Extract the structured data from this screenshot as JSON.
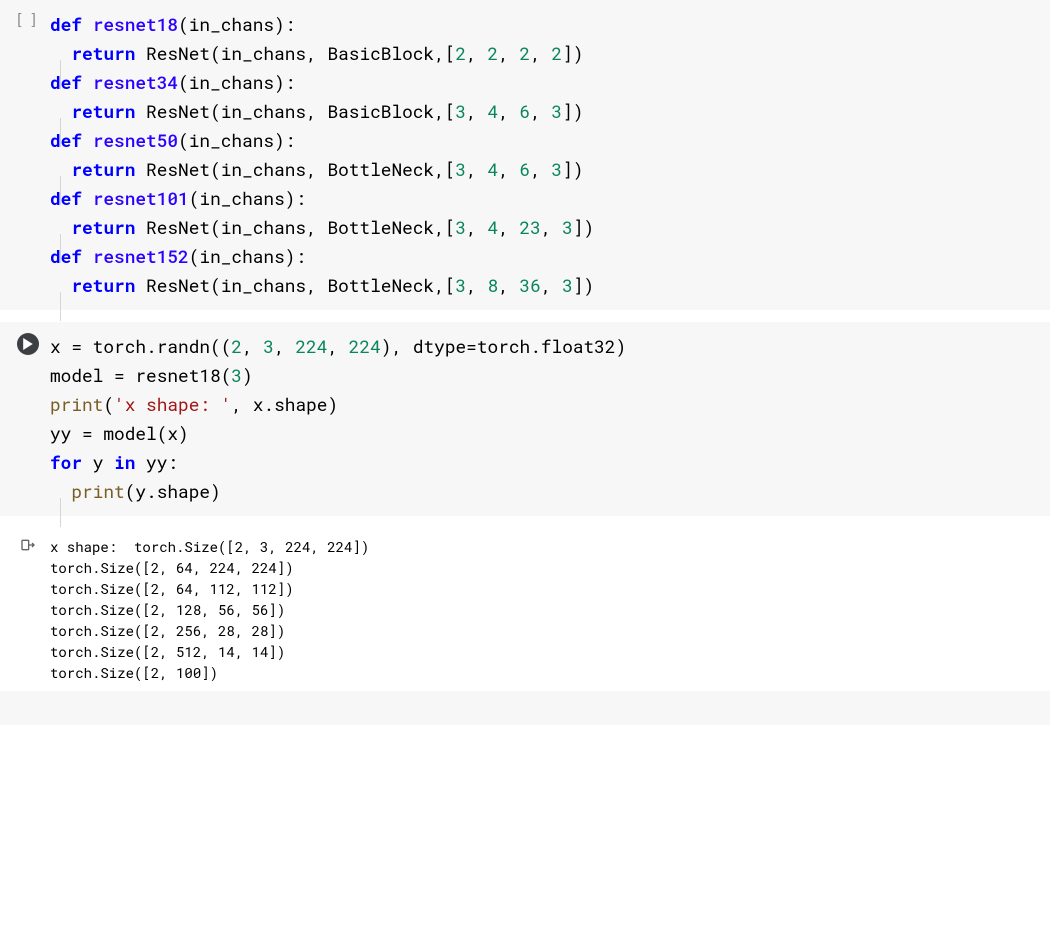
{
  "cells": [
    {
      "status": "idle",
      "code": [
        [
          {
            "t": "def ",
            "c": "kw"
          },
          {
            "t": "resnet18",
            "c": "fn"
          },
          {
            "t": "(in_chans):",
            "c": "op"
          }
        ],
        [
          {
            "t": "  ",
            "c": "op",
            "guide": true
          },
          {
            "t": "return ",
            "c": "kw"
          },
          {
            "t": "ResNet(in_chans, BasicBlock,[",
            "c": "op"
          },
          {
            "t": "2",
            "c": "num"
          },
          {
            "t": ", ",
            "c": "op"
          },
          {
            "t": "2",
            "c": "num"
          },
          {
            "t": ", ",
            "c": "op"
          },
          {
            "t": "2",
            "c": "num"
          },
          {
            "t": ", ",
            "c": "op"
          },
          {
            "t": "2",
            "c": "num"
          },
          {
            "t": "])",
            "c": "op"
          }
        ],
        [
          {
            "t": "",
            "c": "op"
          }
        ],
        [
          {
            "t": "def ",
            "c": "kw"
          },
          {
            "t": "resnet34",
            "c": "fn"
          },
          {
            "t": "(in_chans):",
            "c": "op"
          }
        ],
        [
          {
            "t": "  ",
            "c": "op",
            "guide": true
          },
          {
            "t": "return ",
            "c": "kw"
          },
          {
            "t": "ResNet(in_chans, BasicBlock,[",
            "c": "op"
          },
          {
            "t": "3",
            "c": "num"
          },
          {
            "t": ", ",
            "c": "op"
          },
          {
            "t": "4",
            "c": "num"
          },
          {
            "t": ", ",
            "c": "op"
          },
          {
            "t": "6",
            "c": "num"
          },
          {
            "t": ", ",
            "c": "op"
          },
          {
            "t": "3",
            "c": "num"
          },
          {
            "t": "])",
            "c": "op"
          }
        ],
        [
          {
            "t": "",
            "c": "op"
          }
        ],
        [
          {
            "t": "def ",
            "c": "kw"
          },
          {
            "t": "resnet50",
            "c": "fn"
          },
          {
            "t": "(in_chans):",
            "c": "op"
          }
        ],
        [
          {
            "t": "  ",
            "c": "op",
            "guide": true
          },
          {
            "t": "return ",
            "c": "kw"
          },
          {
            "t": "ResNet(in_chans, BottleNeck,[",
            "c": "op"
          },
          {
            "t": "3",
            "c": "num"
          },
          {
            "t": ", ",
            "c": "op"
          },
          {
            "t": "4",
            "c": "num"
          },
          {
            "t": ", ",
            "c": "op"
          },
          {
            "t": "6",
            "c": "num"
          },
          {
            "t": ", ",
            "c": "op"
          },
          {
            "t": "3",
            "c": "num"
          },
          {
            "t": "])",
            "c": "op"
          }
        ],
        [
          {
            "t": "",
            "c": "op"
          }
        ],
        [
          {
            "t": "def ",
            "c": "kw"
          },
          {
            "t": "resnet101",
            "c": "fn"
          },
          {
            "t": "(in_chans):",
            "c": "op"
          }
        ],
        [
          {
            "t": "  ",
            "c": "op",
            "guide": true
          },
          {
            "t": "return ",
            "c": "kw"
          },
          {
            "t": "ResNet(in_chans, BottleNeck,[",
            "c": "op"
          },
          {
            "t": "3",
            "c": "num"
          },
          {
            "t": ", ",
            "c": "op"
          },
          {
            "t": "4",
            "c": "num"
          },
          {
            "t": ", ",
            "c": "op"
          },
          {
            "t": "23",
            "c": "num"
          },
          {
            "t": ", ",
            "c": "op"
          },
          {
            "t": "3",
            "c": "num"
          },
          {
            "t": "])",
            "c": "op"
          }
        ],
        [
          {
            "t": "",
            "c": "op"
          }
        ],
        [
          {
            "t": "def ",
            "c": "kw"
          },
          {
            "t": "resnet152",
            "c": "fn"
          },
          {
            "t": "(in_chans):",
            "c": "op"
          }
        ],
        [
          {
            "t": "  ",
            "c": "op",
            "guide": true
          },
          {
            "t": "return ",
            "c": "kw"
          },
          {
            "t": "ResNet(in_chans, BottleNeck,[",
            "c": "op"
          },
          {
            "t": "3",
            "c": "num"
          },
          {
            "t": ", ",
            "c": "op"
          },
          {
            "t": "8",
            "c": "num"
          },
          {
            "t": ", ",
            "c": "op"
          },
          {
            "t": "36",
            "c": "num"
          },
          {
            "t": ", ",
            "c": "op"
          },
          {
            "t": "3",
            "c": "num"
          },
          {
            "t": "])",
            "c": "op"
          }
        ]
      ]
    },
    {
      "status": "executed",
      "code": [
        [
          {
            "t": "x = torch.randn((",
            "c": "op"
          },
          {
            "t": "2",
            "c": "num"
          },
          {
            "t": ", ",
            "c": "op"
          },
          {
            "t": "3",
            "c": "num"
          },
          {
            "t": ", ",
            "c": "op"
          },
          {
            "t": "224",
            "c": "num"
          },
          {
            "t": ", ",
            "c": "op"
          },
          {
            "t": "224",
            "c": "num"
          },
          {
            "t": "), dtype=torch.float32)",
            "c": "op"
          }
        ],
        [
          {
            "t": "model = resnet18(",
            "c": "op"
          },
          {
            "t": "3",
            "c": "num"
          },
          {
            "t": ")",
            "c": "op"
          }
        ],
        [
          {
            "t": "print",
            "c": "builtin"
          },
          {
            "t": "(",
            "c": "op"
          },
          {
            "t": "'x shape: '",
            "c": "str"
          },
          {
            "t": ", x.shape)",
            "c": "op"
          }
        ],
        [
          {
            "t": "yy = model(x)",
            "c": "op"
          }
        ],
        [
          {
            "t": "for ",
            "c": "kw"
          },
          {
            "t": "y ",
            "c": "op"
          },
          {
            "t": "in ",
            "c": "kw"
          },
          {
            "t": "yy:",
            "c": "op"
          }
        ],
        [
          {
            "t": "  ",
            "c": "op",
            "guide": true
          },
          {
            "t": "print",
            "c": "builtin"
          },
          {
            "t": "(y.shape)",
            "c": "op"
          }
        ]
      ],
      "output": [
        "x shape:  torch.Size([2, 3, 224, 224])",
        "torch.Size([2, 64, 224, 224])",
        "torch.Size([2, 64, 112, 112])",
        "torch.Size([2, 128, 56, 56])",
        "torch.Size([2, 256, 28, 28])",
        "torch.Size([2, 512, 14, 14])",
        "torch.Size([2, 100])"
      ]
    }
  ],
  "trailing_cell": true
}
